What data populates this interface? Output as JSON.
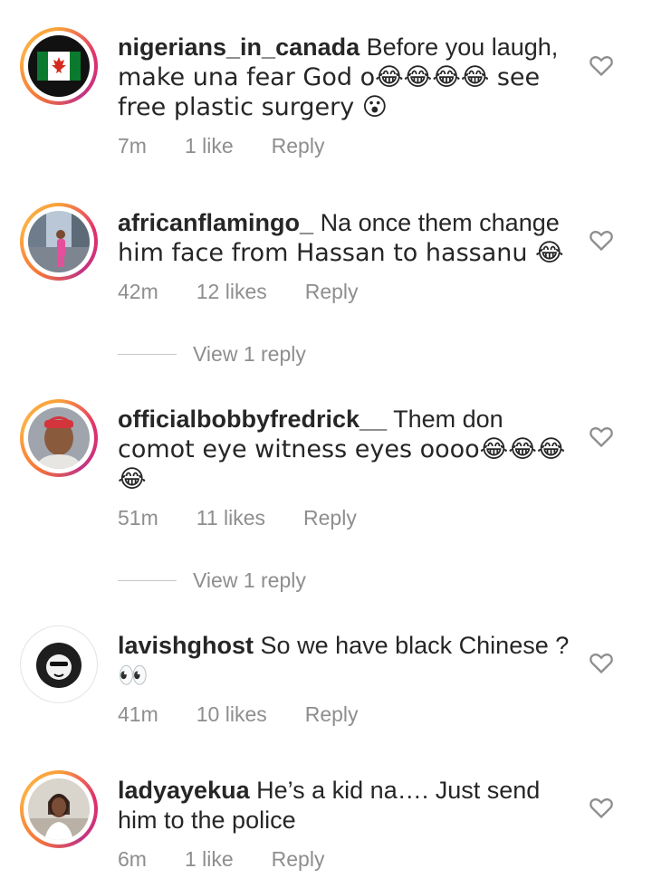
{
  "comments": [
    {
      "username": "nigerians_in_canada",
      "text_lines": [
        "Before you laugh,",
        "make una fear God o😂😂😂😂 see",
        "free plastic surgery 😮"
      ],
      "time": "7m",
      "likes": "1 like",
      "reply": "Reply"
    },
    {
      "username": "africanflamingo_",
      "text_lines": [
        "Na once them change",
        "him face from Hassan to hassanu 😂"
      ],
      "time": "42m",
      "likes": "12 likes",
      "reply": "Reply",
      "view_replies": "View 1 reply"
    },
    {
      "username": "officialbobbyfredrick__",
      "text_lines": [
        "Them don",
        "comot eye witness eyes oooo😂😂😂",
        "😂"
      ],
      "time": "51m",
      "likes": "11 likes",
      "reply": "Reply",
      "view_replies": "View 1 reply"
    },
    {
      "username": "lavishghost",
      "text_lines": [
        "So we have black Chinese ?",
        "👀"
      ],
      "time": "41m",
      "likes": "10 likes",
      "reply": "Reply"
    },
    {
      "username": "ladyayekua",
      "text_lines": [
        "He’s a kid na…. Just send",
        "him to the police"
      ],
      "time": "6m",
      "likes": "1 like",
      "reply": "Reply"
    }
  ],
  "colors": {
    "text": "#262626",
    "secondary": "#8e8e8e",
    "flag_green": "#0a7a2e",
    "flag_red": "#d52b1e"
  }
}
